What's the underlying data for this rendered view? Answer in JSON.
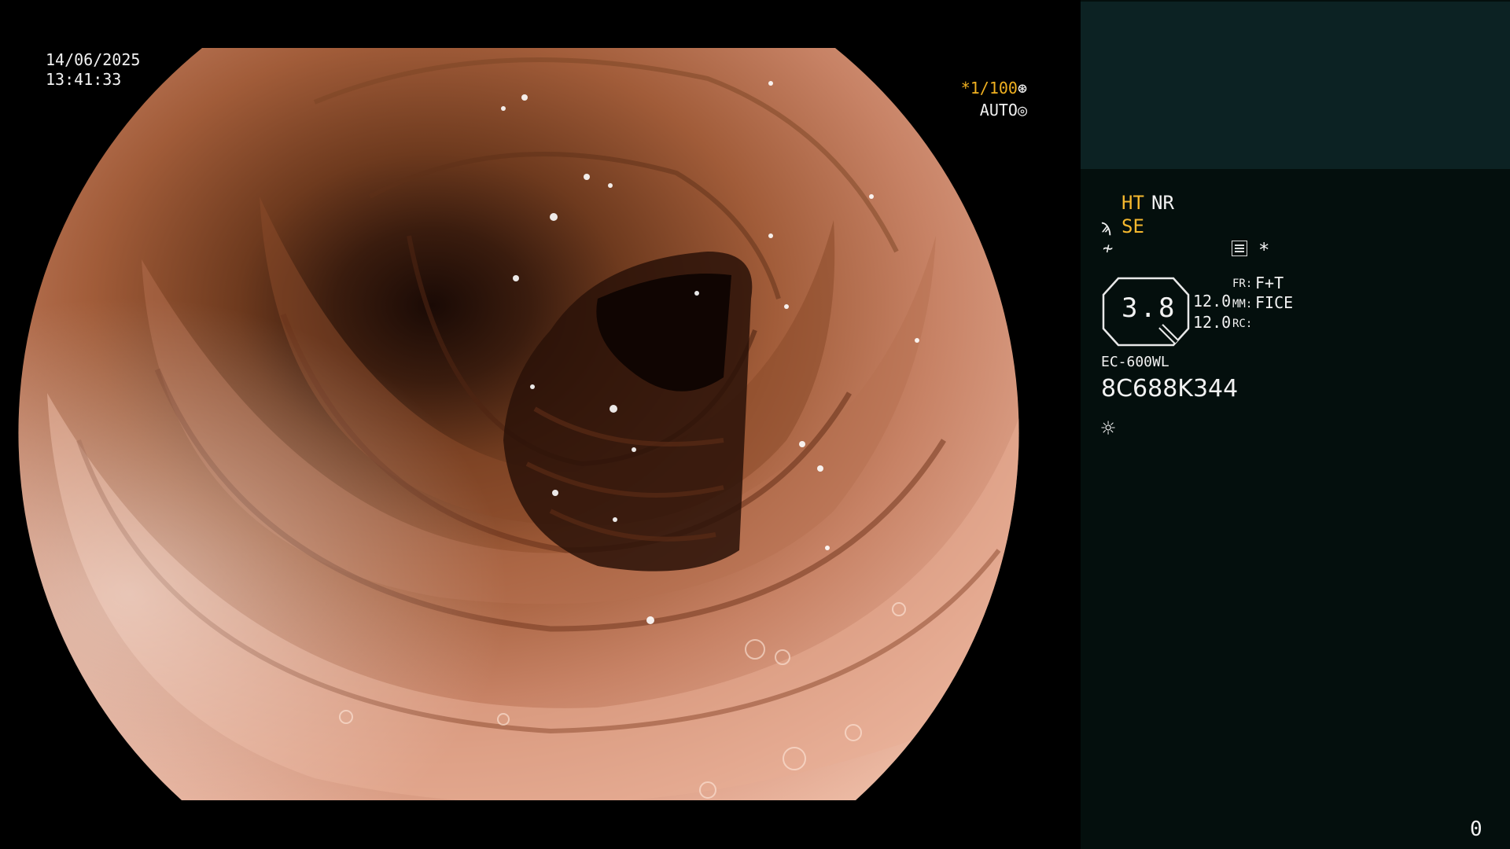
{
  "video": {
    "date": "14/06/2025",
    "time": "13:41:33",
    "shutter_label": "*1/100",
    "shutter_icon": "⊛",
    "iris_label": "AUTO",
    "iris_icon": "◎"
  },
  "panel": {
    "ht": "HT",
    "nr": "NR",
    "se_icon": "ϡ",
    "se": "SE",
    "enhance_icon": "≁",
    "star": "*",
    "zoom": "3.8",
    "value_1": "12.0",
    "value_2": "12.0",
    "fr_key": "FR:",
    "fr_value": "F+T",
    "mm_key": "MM:",
    "mm_value": "FICE",
    "rc_key": "RC:",
    "scope_model": "EC-600WL",
    "scope_serial": "8C688K344",
    "light_icon": "☼",
    "counter": "0"
  },
  "colors": {
    "panel_bg": "#040f0d",
    "panel_top_bg": "#0c2223",
    "amber": "#f5b82e",
    "tissue_pink": "#d9957a",
    "tissue_brown": "#6e3a1e"
  },
  "icons": [
    "shutter-icon",
    "auto-iris-icon",
    "structure-enhance-icon",
    "color-enhance-icon",
    "menu-icon",
    "light-source-icon"
  ]
}
